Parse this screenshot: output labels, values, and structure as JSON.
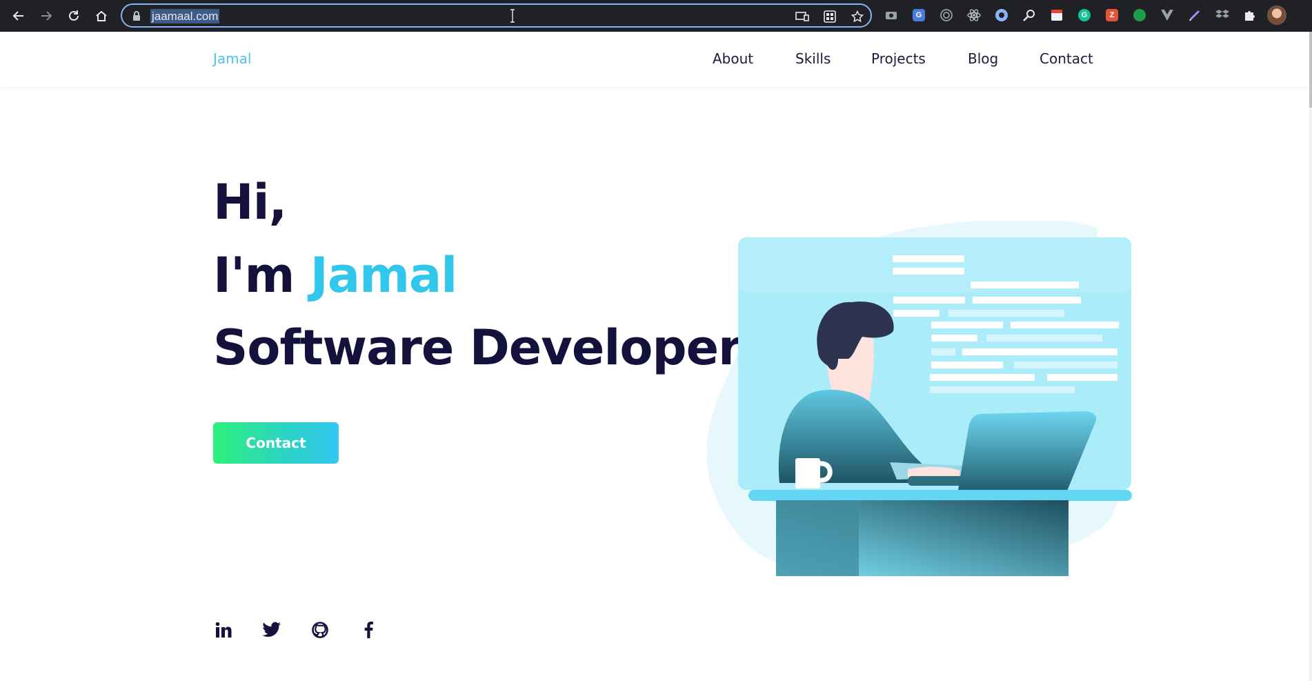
{
  "browser": {
    "url": "jaamaal.com",
    "toolbar_icons": [
      "back-icon",
      "forward-icon",
      "reload-icon",
      "home-icon"
    ],
    "omnibox_icons": [
      "cast-icon",
      "qr-code-icon",
      "bookmark-star-icon"
    ],
    "extension_icons": [
      "camera-icon",
      "translate-icon",
      "target-icon",
      "react-devtools-icon",
      "circle-extension-icon",
      "magnifier-extension-icon",
      "calendar-extension-icon",
      "grammarly-icon",
      "pen-extension-icon",
      "green-dot-extension-icon",
      "vue-devtools-icon",
      "color-picker-icon",
      "dropbox-icon",
      "extensions-puzzle-icon",
      "profile-avatar"
    ]
  },
  "site": {
    "brand": "Jamal",
    "nav": [
      "About",
      "Skills",
      "Projects",
      "Blog",
      "Contact"
    ]
  },
  "hero": {
    "greeting": "Hi,",
    "intro_prefix": "I'm",
    "name": "Jamal",
    "role": "Software Developer",
    "cta_label": "Contact"
  },
  "social_links": [
    "linkedin-icon",
    "twitter-icon",
    "github-icon",
    "facebook-icon"
  ],
  "colors": {
    "accent": "#31c7ec",
    "heading": "#14113d",
    "cta_gradient_start": "#2ef07c",
    "cta_gradient_end": "#33c7f2",
    "chrome_bg": "#202124"
  }
}
